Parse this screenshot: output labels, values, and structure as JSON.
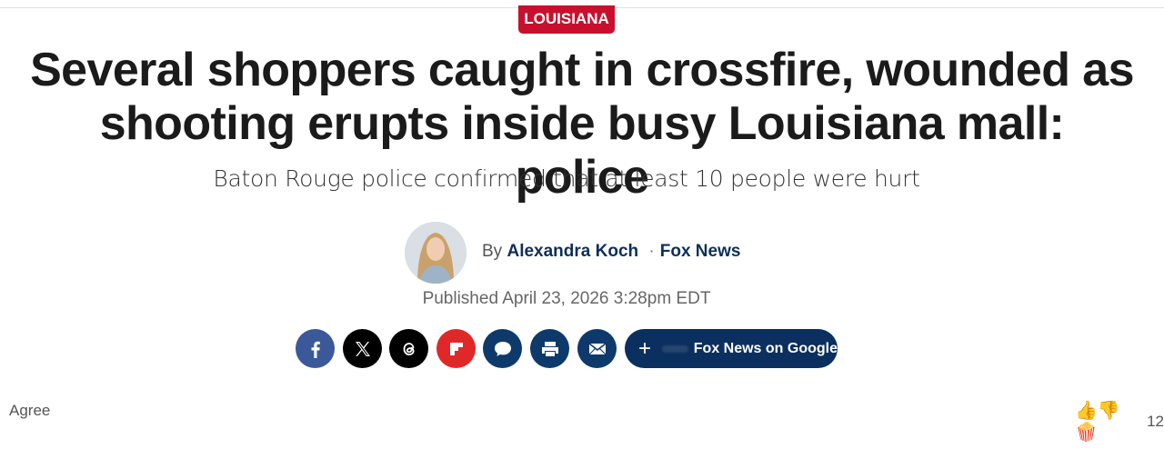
{
  "category": "LOUISIANA",
  "headline": "Several shoppers caught in crossfire, wounded as shooting erupts inside busy Louisiana mall: police",
  "subheadline": "Baton Rouge police confirmed that at least 10 people were hurt",
  "byline": {
    "prefix": "By",
    "author": "Alexandra Koch",
    "separator": "·",
    "outlet": "Fox News"
  },
  "published": "Published April 23, 2026 3:28pm EDT",
  "share": {
    "icons": [
      "facebook-icon",
      "x-icon",
      "threads-icon",
      "flipboard-icon",
      "comments-icon",
      "print-icon",
      "email-icon"
    ],
    "google_plus": "+",
    "google_label": "Fox News on Google"
  },
  "footer": {
    "agree_label": "Agree",
    "reaction_emojis": "👍👎🍿",
    "reaction_count": "12"
  },
  "colors": {
    "category_red": "#c8102e",
    "navy": "#0b2f5e",
    "facebook": "#3b5998",
    "flipboard": "#e12828",
    "comments": "#0d3a6b"
  }
}
